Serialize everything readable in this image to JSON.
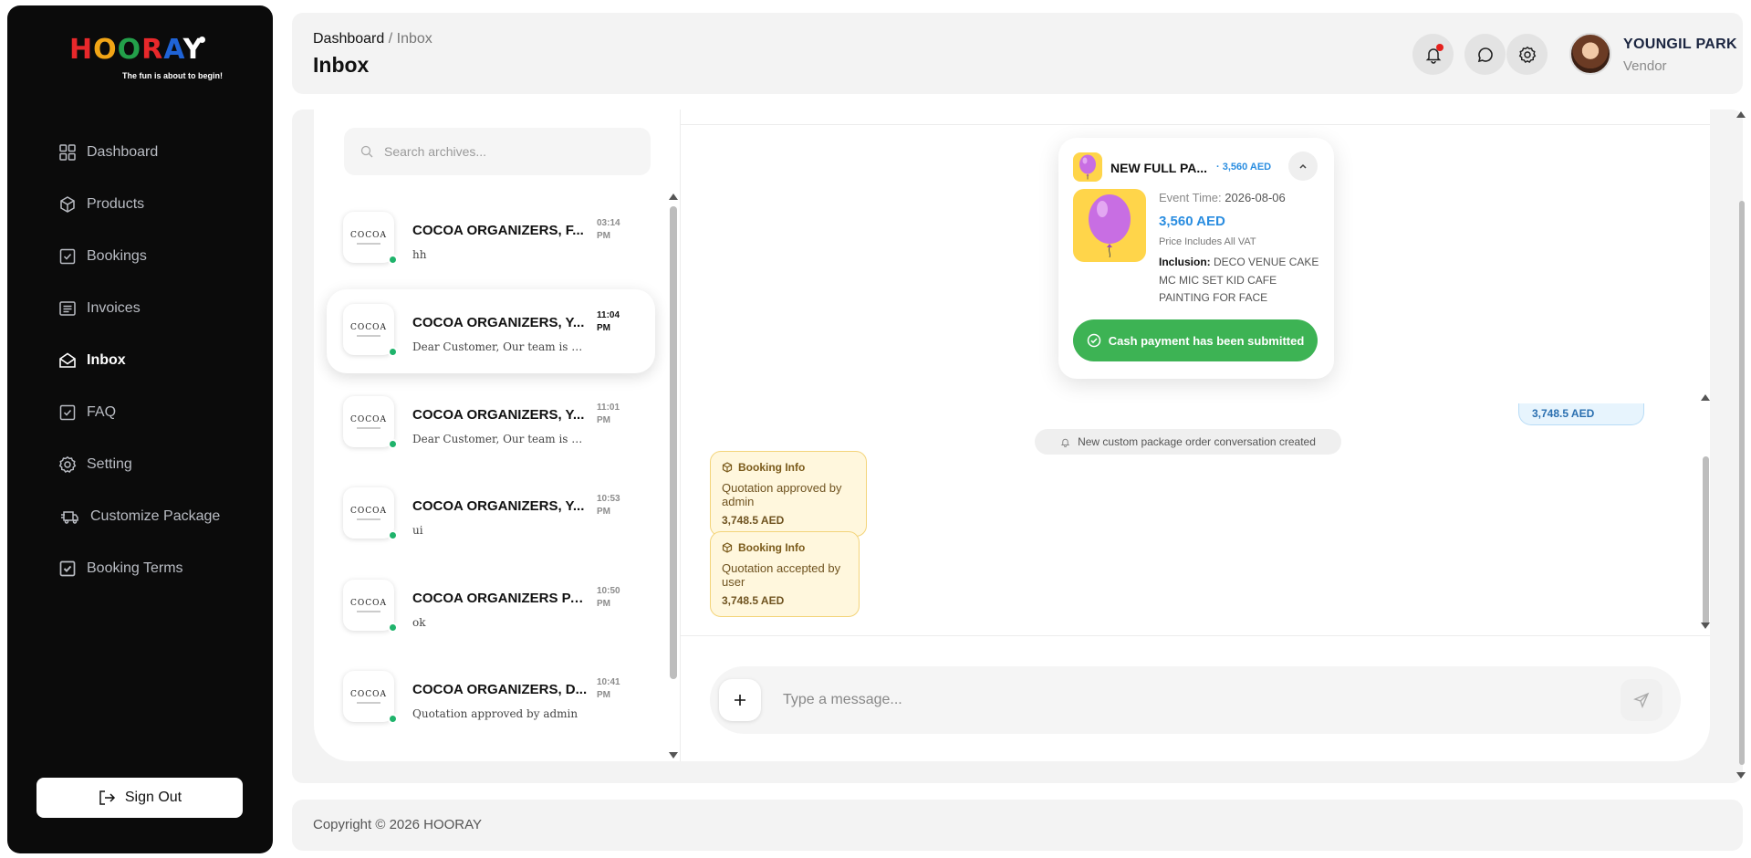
{
  "brand": {
    "logo_letters": [
      "H",
      "O",
      "O",
      "R",
      "A",
      "Y"
    ],
    "tagline": "The fun is about to begin!"
  },
  "sidebar": {
    "items": [
      {
        "label": "Dashboard",
        "icon": "grid-icon"
      },
      {
        "label": "Products",
        "icon": "box-icon"
      },
      {
        "label": "Bookings",
        "icon": "check-square-icon"
      },
      {
        "label": "Invoices",
        "icon": "receipt-icon"
      },
      {
        "label": "Inbox",
        "icon": "envelope-open-icon",
        "active": true
      },
      {
        "label": "FAQ",
        "icon": "check-square-icon"
      },
      {
        "label": "Setting",
        "icon": "gear-icon"
      },
      {
        "label": "Customize Package",
        "icon": "truck-icon"
      },
      {
        "label": "Booking Terms",
        "icon": "check-square-filled-icon"
      }
    ],
    "sign_out": "Sign Out"
  },
  "header": {
    "breadcrumb_root": "Dashboard",
    "breadcrumb_separator": "/",
    "breadcrumb_current": "Inbox",
    "title": "Inbox",
    "user_name": "YOUNGIL PARK",
    "user_role": "Vendor"
  },
  "search": {
    "placeholder": "Search archives..."
  },
  "conversations": [
    {
      "name": "COCOA ORGANIZERS, F...",
      "time": "03:14 PM",
      "preview": "hh",
      "online": true,
      "active": false
    },
    {
      "name": "COCOA ORGANIZERS, Y...",
      "time": "11:04 PM",
      "preview": "Dear Customer, Our team is cur...",
      "online": true,
      "active": true
    },
    {
      "name": "COCOA ORGANIZERS, Y...",
      "time": "11:01 PM",
      "preview": "Dear Customer, Our team is cur...",
      "online": true,
      "active": false
    },
    {
      "name": "COCOA ORGANIZERS, Y...",
      "time": "10:53 PM",
      "preview": "ui",
      "online": true,
      "active": false
    },
    {
      "name": "COCOA ORGANIZERS PA...",
      "time": "10:50 PM",
      "preview": "ok",
      "online": true,
      "active": false
    },
    {
      "name": "COCOA ORGANIZERS, D...",
      "time": "10:41 PM",
      "preview": "Quotation approved by admin",
      "online": true,
      "active": false
    }
  ],
  "conversation_logo_text": "COCOA",
  "package_card": {
    "title": "NEW FULL PA...",
    "price_short": "· 3,560 AED",
    "event_label": "Event Time:",
    "event_time": "2026-08-06",
    "price": "3,560 AED",
    "vat_note": "Price Includes All VAT",
    "inclusion_label": "Inclusion:",
    "inclusion_text": "DECO VENUE CAKE MC MIC SET KID CAFE PAINTING FOR FACE",
    "payment_status": "Cash payment has been submitted",
    "balloon_color": "#c86ee3",
    "thumb_color": "#ffd54a"
  },
  "bubble_right_partial": "3,748.5 AED",
  "system_message": "New custom package order conversation created",
  "booking_messages": [
    {
      "title": "Booking Info",
      "text": "Quotation approved by admin",
      "amount": "3,748.5 AED"
    },
    {
      "title": "Booking Info",
      "text": "Quotation accepted by user",
      "amount": "3,748.5 AED"
    }
  ],
  "composer": {
    "placeholder": "Type a message..."
  },
  "footer": {
    "copyright": "Copyright © 2026 HOORAY"
  },
  "colors": {
    "sidebar_bg": "#0b0b0b",
    "accent_blue": "#2a8de0",
    "success_green": "#3db354",
    "online_green": "#1fb36b",
    "booking_bg": "#fff7dd",
    "notification_red": "#e5211d"
  }
}
